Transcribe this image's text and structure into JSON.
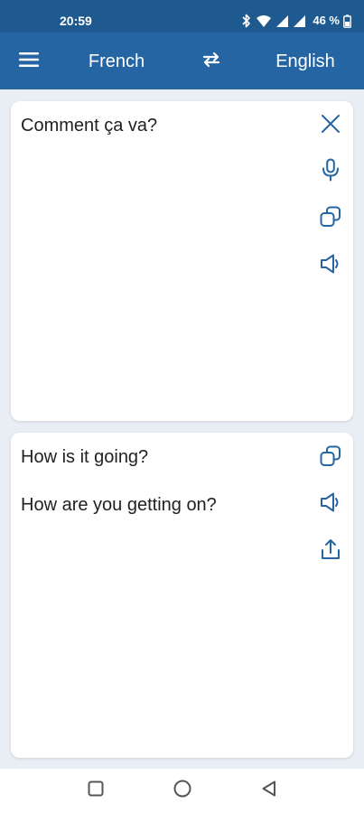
{
  "status_bar": {
    "time": "20:59",
    "battery": "46 %",
    "icons": [
      "bluetooth-icon",
      "wifi-icon",
      "signal-icon",
      "signal-icon",
      "battery-icon"
    ]
  },
  "app_bar": {
    "menu_icon": "menu-icon",
    "source_language": "French",
    "swap_icon": "swap-icon",
    "target_language": "English"
  },
  "source_card": {
    "text": "Comment ça va?",
    "actions": [
      "close-icon",
      "microphone-icon",
      "copy-icon",
      "speaker-icon"
    ]
  },
  "target_card": {
    "translations": [
      "How is it going?",
      "How are you getting on?"
    ],
    "actions": [
      "copy-icon",
      "speaker-icon",
      "share-icon"
    ]
  },
  "nav_bar": {
    "buttons": [
      "recents-square-icon",
      "home-circle-icon",
      "back-triangle-icon"
    ]
  },
  "colors": {
    "status_bar": "#1e5a8f",
    "app_bar": "#2565a3",
    "accent_icon": "#2565a3",
    "background": "#e9eef5",
    "card": "#ffffff",
    "text": "#202124"
  }
}
